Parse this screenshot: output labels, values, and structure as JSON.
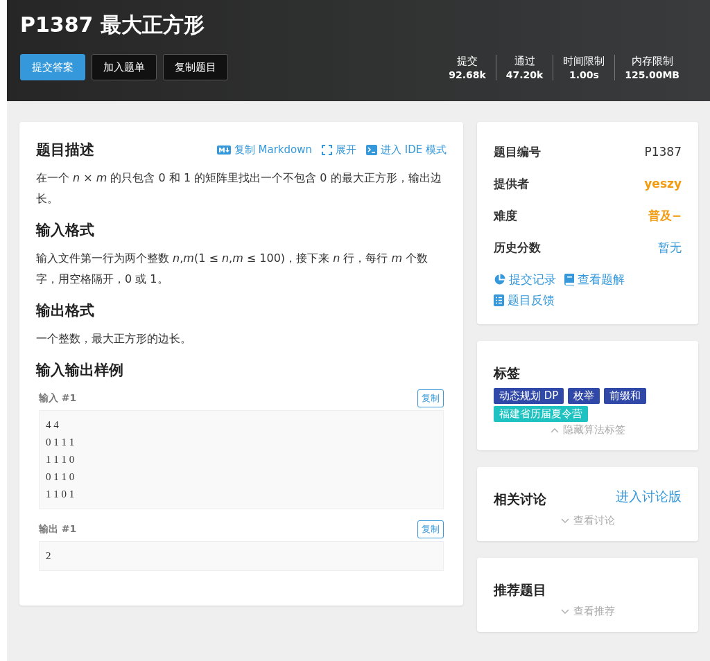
{
  "header": {
    "title": "P1387 最大正方形",
    "buttons": [
      {
        "label": "提交答案",
        "primary": true
      },
      {
        "label": "加入题单",
        "primary": false
      },
      {
        "label": "复制题目",
        "primary": false
      }
    ],
    "stats": [
      {
        "label": "提交",
        "value": "92.68k"
      },
      {
        "label": "通过",
        "value": "47.20k"
      },
      {
        "label": "时间限制",
        "value": "1.00s"
      },
      {
        "label": "内存限制",
        "value": "125.00MB"
      }
    ]
  },
  "problem": {
    "title": "题目描述",
    "actions": [
      {
        "kind": "markdown",
        "label": "复制 Markdown"
      },
      {
        "kind": "expand",
        "label": "展开"
      },
      {
        "kind": "ide",
        "label": "进入 IDE 模式"
      }
    ],
    "description": "在一个 *n* × *m* 的只包含 0 和 1 的矩阵里找出一个不包含 0 的最大正方形，输出边长。",
    "input_title": "输入格式",
    "input_format": "输入文件第一行为两个整数 *n*,*m*(1 ≤ *n*,*m* ≤ 100)，接下来 *n* 行，每行 *m* 个数字，用空格隔开，0 或 1。",
    "output_title": "输出格式",
    "output_format": "一个整数，最大正方形的边长。",
    "samples_title": "输入输出样例",
    "samples": [
      {
        "label": "输入 #1",
        "copy": "复制",
        "content": "4 4\n0 1 1 1\n1 1 1 0\n0 1 1 0\n1 1 0 1"
      },
      {
        "label": "输出 #1",
        "copy": "复制",
        "content": "2"
      }
    ]
  },
  "info": {
    "rows": [
      {
        "label": "题目编号",
        "value": "P1387",
        "kind": "plain"
      },
      {
        "label": "提供者",
        "value": "yeszy",
        "kind": "user"
      },
      {
        "label": "难度",
        "value": "普及−",
        "kind": "difficulty"
      },
      {
        "label": "历史分数",
        "value": "暂无",
        "kind": "link"
      }
    ],
    "links": [
      {
        "kind": "records",
        "label": "提交记录"
      },
      {
        "kind": "solutions",
        "label": "查看题解"
      },
      {
        "kind": "feedback",
        "label": "题目反馈"
      }
    ]
  },
  "tags": {
    "title": "标签",
    "items": [
      {
        "label": "动态规划 DP",
        "color": "#3049a8"
      },
      {
        "label": "枚举",
        "color": "#3049a8"
      },
      {
        "label": "前缀和",
        "color": "#3049a8"
      },
      {
        "label": "福建省历届夏令营",
        "color": "#1ec2c0"
      }
    ],
    "toggle": "隐藏算法标签"
  },
  "discussion": {
    "title": "相关讨论",
    "link": "进入讨论版",
    "toggle": "查看讨论"
  },
  "recommend": {
    "title": "推荐题目",
    "toggle": "查看推荐"
  }
}
